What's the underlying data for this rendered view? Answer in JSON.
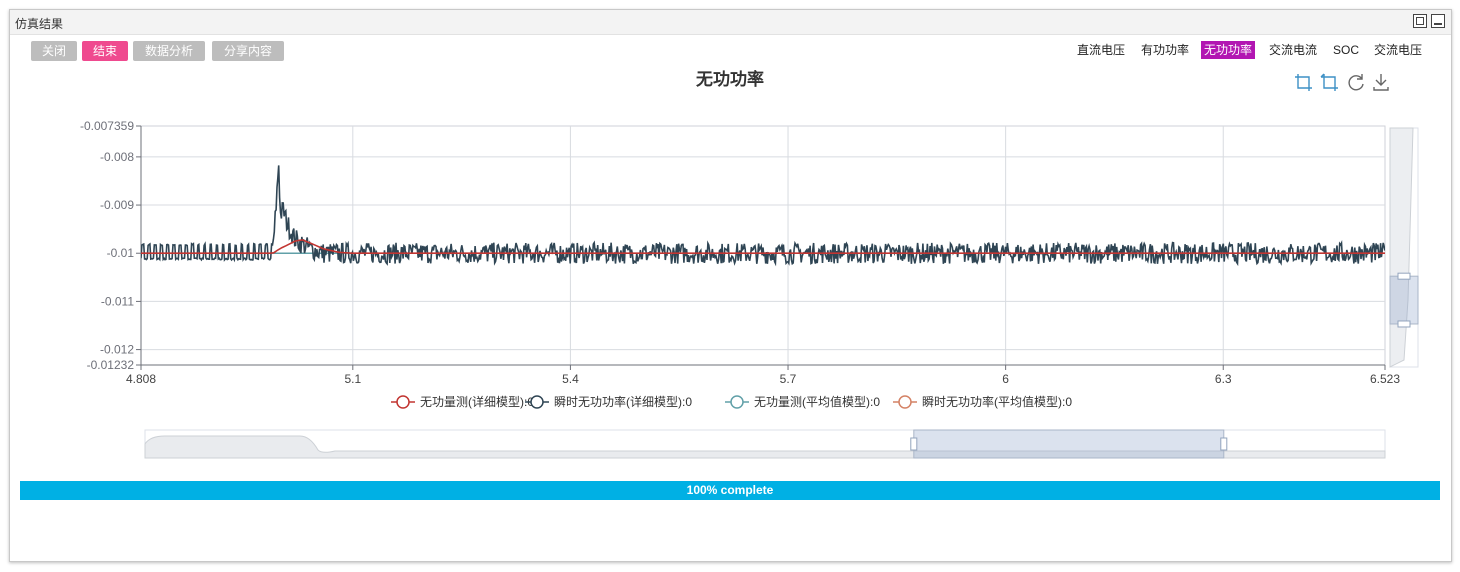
{
  "window": {
    "title": "仿真结果"
  },
  "toolbar": {
    "close": "关闭",
    "end": "结束",
    "analysis": "数据分析",
    "share": "分享内容"
  },
  "tabs": [
    "直流电压",
    "有功功率",
    "无功功率",
    "交流电流",
    "SOC",
    "交流电压"
  ],
  "active_tab_index": 2,
  "colors": {
    "accent_pink": "#ef4a8f",
    "active_tab": "#b216b2",
    "progress": "#00b0e4",
    "series1": "#c23531",
    "series2": "#2f4554",
    "series3": "#61a0a8",
    "series4": "#d48265"
  },
  "progress": {
    "label": "100% complete",
    "value": 1.0
  },
  "chart_data": {
    "type": "line",
    "title": "无功功率",
    "xlabel": "",
    "ylabel": "",
    "xlim": [
      4.808,
      6.523
    ],
    "ylim": [
      -0.01232,
      -0.007359
    ],
    "x_ticks": [
      "4.808",
      "5.1",
      "5.4",
      "5.7",
      "6",
      "6.3",
      "6.523"
    ],
    "x_tick_values": [
      4.808,
      5.1,
      5.4,
      5.7,
      6.0,
      6.3,
      6.523
    ],
    "y_ticks": [
      "-0.007359",
      "-0.008",
      "-0.009",
      "-0.01",
      "-0.011",
      "-0.012",
      "-0.01232"
    ],
    "y_tick_values": [
      -0.007359,
      -0.008,
      -0.009,
      -0.01,
      -0.011,
      -0.012,
      -0.01232
    ],
    "grid": true,
    "legend_position": "bottom",
    "series": [
      {
        "name": "无功量测(详细模型):0",
        "color": "#c23531",
        "x": [
          4.808,
          4.99,
          5.0,
          5.01,
          5.02,
          5.03,
          5.04,
          5.06,
          5.08,
          5.1,
          6.523
        ],
        "y": [
          -0.01,
          -0.01,
          -0.0099,
          -0.00983,
          -0.00975,
          -0.00972,
          -0.00978,
          -0.00991,
          -0.00998,
          -0.01,
          -0.01
        ]
      },
      {
        "name": "瞬时无功功率(详细模型):0",
        "color": "#2f4554",
        "note_shape": "noisy",
        "base": -0.01,
        "amplitude": 0.00022,
        "x": [
          4.808,
          4.99,
          4.998,
          5.0,
          5.004,
          5.01,
          5.02,
          5.04,
          5.06,
          6.523
        ],
        "y": [
          -0.01,
          -0.01,
          -0.0081,
          -0.0092,
          -0.0091,
          -0.0094,
          -0.0097,
          -0.0099,
          -0.01,
          -0.01
        ]
      },
      {
        "name": "无功量测(平均值模型):0",
        "color": "#61a0a8",
        "x": [
          4.808,
          6.523
        ],
        "y": [
          -0.01,
          -0.01
        ]
      },
      {
        "name": "瞬时无功功率(平均值模型):0",
        "color": "#d48265",
        "x": [
          4.808,
          6.523
        ],
        "y": [
          -0.01,
          -0.01
        ]
      }
    ],
    "x_zoom": [
      0.62,
      0.87
    ],
    "y_zoom": [
      0.62,
      0.82
    ]
  }
}
